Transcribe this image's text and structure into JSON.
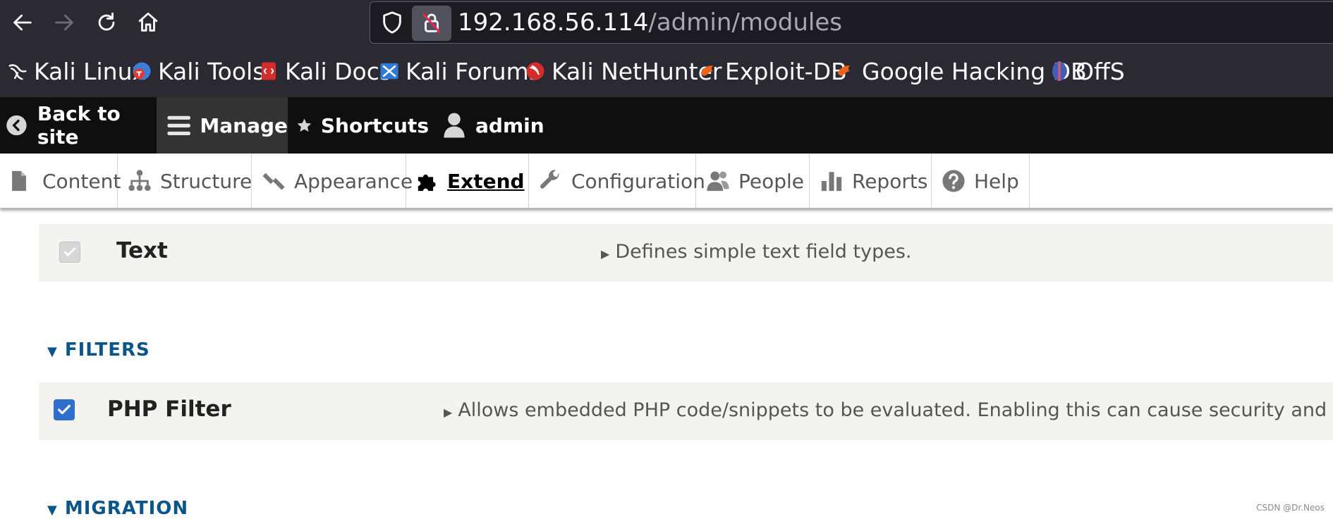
{
  "browser": {
    "url_host": "192.168.56.114",
    "url_path": "/admin/modules",
    "bookmarks": [
      {
        "label": "Kali Linux",
        "icon": "kali-dragon-icon"
      },
      {
        "label": "Kali Tools",
        "icon": "kali-tools-icon"
      },
      {
        "label": "Kali Docs",
        "icon": "kali-docs-icon"
      },
      {
        "label": "Kali Forums",
        "icon": "kali-forums-icon"
      },
      {
        "label": "Kali NetHunter",
        "icon": "kali-nethunter-icon"
      },
      {
        "label": "Exploit-DB",
        "icon": "exploit-db-icon"
      },
      {
        "label": "Google Hacking DB",
        "icon": "google-hacking-db-icon"
      },
      {
        "label": "OffS",
        "icon": "offsec-icon"
      }
    ]
  },
  "toolbar": {
    "back": "Back to site",
    "manage": "Manage",
    "shortcuts": "Shortcuts",
    "user": "admin"
  },
  "tray": {
    "content": "Content",
    "structure": "Structure",
    "appearance": "Appearance",
    "extend": "Extend",
    "configuration": "Configuration",
    "people": "People",
    "reports": "Reports",
    "help": "Help"
  },
  "modules": {
    "text": {
      "name": "Text",
      "description": "Defines simple text field types.",
      "checked": true,
      "disabled": true
    },
    "filters_heading": "FILTERS",
    "php_filter": {
      "name": "PHP Filter",
      "description": "Allows embedded PHP code/snippets to be evaluated. Enabling this can cause security and per",
      "checked": true,
      "disabled": false
    },
    "migration_heading": "MIGRATION"
  },
  "watermark": "CSDN @Dr.Neos",
  "colors": {
    "browser_bg": "#2b2a33",
    "toolbar_bg": "#0f0f0f",
    "link_blue": "#0a568a",
    "checkbox_blue": "#2f6ecc"
  }
}
